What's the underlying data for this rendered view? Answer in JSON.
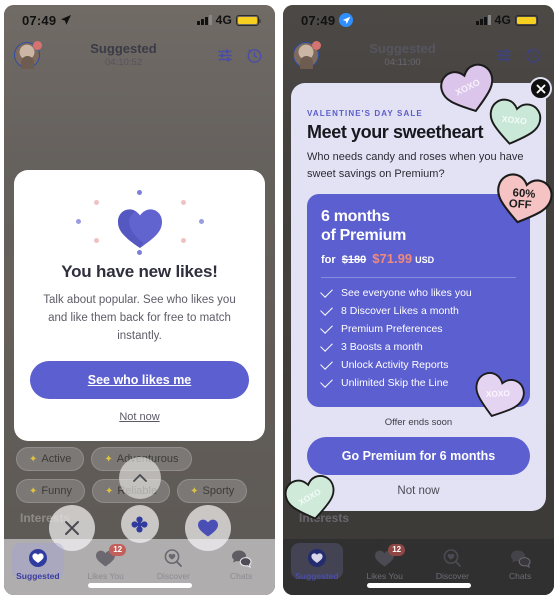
{
  "panels": [
    {
      "status": {
        "time": "07:49",
        "location_icon": "location-arrow-icon",
        "network": "4G",
        "signal_icon": "signal-bars-icon",
        "battery_icon": "battery-icon"
      },
      "header": {
        "title": "Suggested",
        "timer": "04:10:52",
        "avatar": "user-avatar",
        "filter_icon": "filter-sliders-icon",
        "history_icon": "history-clock-icon"
      }
    },
    {
      "status": {
        "time": "07:49",
        "location_icon": "location-arrow-icon",
        "network": "4G",
        "signal_icon": "signal-bars-icon",
        "battery_icon": "battery-icon"
      },
      "header": {
        "title": "Suggested",
        "timer": "04:11:00",
        "avatar": "user-avatar",
        "filter_icon": "filter-sliders-icon",
        "history_icon": "history-clock-icon"
      }
    }
  ],
  "background_card": {
    "interests_label": "Interests",
    "chips_row1": [
      "Active",
      "Adventurous"
    ],
    "chips_row2": [
      "Funny",
      "Reliable",
      "Sporty"
    ],
    "actions": [
      "pass-x-button",
      "super-like-button",
      "like-heart-button"
    ],
    "expand_icon": "chevron-up-icon"
  },
  "bottom_nav": {
    "items": [
      {
        "label": "Suggested",
        "icon": "heart-circle-icon",
        "active": true,
        "badge": ""
      },
      {
        "label": "Likes You",
        "icon": "heart-icon",
        "active": false,
        "badge": "12"
      },
      {
        "label": "Discover",
        "icon": "search-heart-icon",
        "active": false,
        "badge": ""
      },
      {
        "label": "Chats",
        "icon": "chat-bubbles-icon",
        "active": false,
        "badge": ""
      }
    ]
  },
  "likes_modal": {
    "illustration": "purple-heart-sparkle-icon",
    "title": "You have new likes!",
    "body": "Talk about popular. See who likes you and like them back for free to match instantly.",
    "primary_label": "See who likes me",
    "secondary_label": "Not now"
  },
  "sale_modal": {
    "close_icon": "close-x-icon",
    "eyebrow": "VALENTINE'S DAY SALE",
    "title": "Meet your sweetheart",
    "body": "Who needs candy and roses when you have sweet savings on Premium?",
    "price_card": {
      "line1": "6 months",
      "line2": "of Premium",
      "for_label": "for",
      "old_price": "$180",
      "new_price": "$71.99",
      "currency": "USD"
    },
    "discount_badge": {
      "pct": "60%",
      "word": "OFF"
    },
    "features": [
      "See everyone who likes you",
      "8 Discover Likes a month",
      "Premium Preferences",
      "3 Boosts a month",
      "Unlock Activity Reports",
      "Unlimited Skip the Line"
    ],
    "offer_note": "Offer ends soon",
    "cta_label": "Go Premium for 6 months",
    "dismiss_label": "Not now",
    "candy_hearts": [
      {
        "text": "XOXO",
        "color": "#dcc5ea"
      },
      {
        "text": "XOXO",
        "color": "#c9e8d8"
      },
      {
        "text": "XOXO",
        "color": "#e4d4f2"
      },
      {
        "text": "XOXO",
        "color": "#cfead9"
      }
    ]
  },
  "colors": {
    "accent": "#5c5fd0",
    "sale_bg": "#e2e2f4",
    "price_new": "#f08a7a",
    "badge_red": "#c4605c",
    "badge_pink": "#f6c3c4"
  }
}
